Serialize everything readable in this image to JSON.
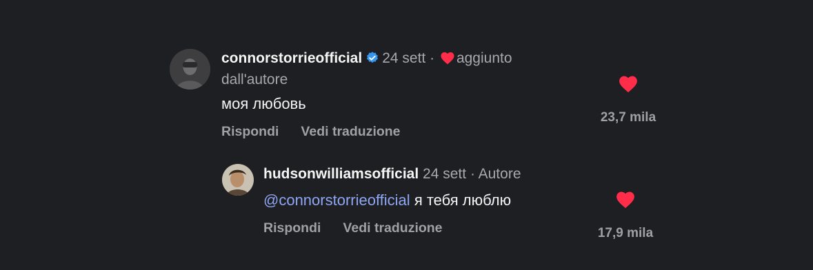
{
  "comments": [
    {
      "username": "connorstorrieofficial",
      "verified_icon": "verified-badge-icon",
      "date": "24 sett",
      "separator": "·",
      "liked_by_author_icon": "heart-icon",
      "liked_by_author": "aggiunto dall'autore",
      "text": "моя любовь",
      "reply_label": "Rispondi",
      "translate_label": "Vedi traduzione",
      "like_count": "23,7 mila",
      "liked": true
    },
    {
      "username": "hudsonwilliamsofficial",
      "date": "24 sett",
      "separator": "·",
      "author_badge": "Autore",
      "mention": "@connorstorrieofficial",
      "text": "я тебя люблю",
      "reply_label": "Rispondi",
      "translate_label": "Vedi traduzione",
      "like_count": "17,9 mila",
      "liked": true
    }
  ],
  "colors": {
    "background": "#1e1f23",
    "heart": "#ff2d4a",
    "verified": "#3797f0",
    "mention": "#8fa6f2",
    "secondary_text": "#a8a8ad"
  }
}
